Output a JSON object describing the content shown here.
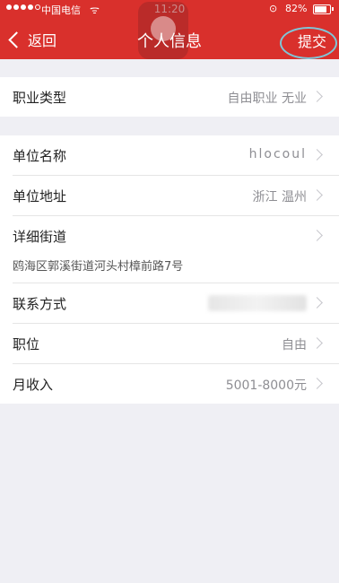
{
  "status_bar": {
    "carrier": "中国电信",
    "wifi_icon": "wifi-icon",
    "time": "11:20",
    "battery_percent": "82%",
    "battery_level": 0.82
  },
  "nav": {
    "back_label": "返回",
    "title": "个人信息",
    "submit_label": "提交"
  },
  "section1": {
    "job_type": {
      "label": "职业类型",
      "value": "自由职业 无业"
    }
  },
  "section2": {
    "company_name": {
      "label": "单位名称",
      "value": "hlocoul"
    },
    "company_address": {
      "label": "单位地址",
      "value": "浙江 温州"
    },
    "street": {
      "label": "详细街道",
      "value": "鸥海区郭溪街道河头村樟前路7号"
    },
    "contact": {
      "label": "联系方式",
      "value": ""
    },
    "position": {
      "label": "职位",
      "value": "自由"
    },
    "income": {
      "label": "月收入",
      "value": "5001-8000元"
    }
  },
  "colors": {
    "header_bg": "#d9302c",
    "page_bg": "#efeff4",
    "annotation_ellipse": "#7fc6d8"
  }
}
